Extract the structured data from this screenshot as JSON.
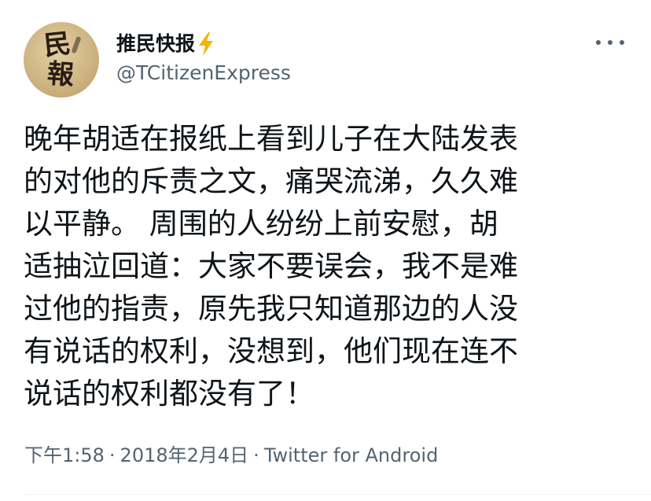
{
  "author": {
    "display_name": "推民快报",
    "handle": "@TCitizenExpress",
    "avatar_glyphs": [
      "民",
      "報"
    ],
    "verified_icon": "lightning-bolt-icon"
  },
  "menu": {
    "icon": "more-options-icon"
  },
  "tweet": {
    "lines": [
      "晚年胡适在报纸上看到儿子在大陆发表",
      "的对他的斥责之文，痛哭流涕，久久难",
      "以平静。 周围的人纷纷上前安慰，胡",
      "适抽泣回道：大家不要误会，我不是难",
      "过他的指责，原先我只知道那边的人没",
      "有说话的权利，没想到，他们现在连不",
      "说话的权利都没有了！"
    ]
  },
  "meta": {
    "time": "下午1:58",
    "date": "2018年2月4日",
    "source": "Twitter for Android",
    "separator": "·"
  },
  "colors": {
    "text": "#0f1419",
    "secondary": "#536471",
    "bolt": "#f4b400",
    "divider": "#eff3f4"
  }
}
